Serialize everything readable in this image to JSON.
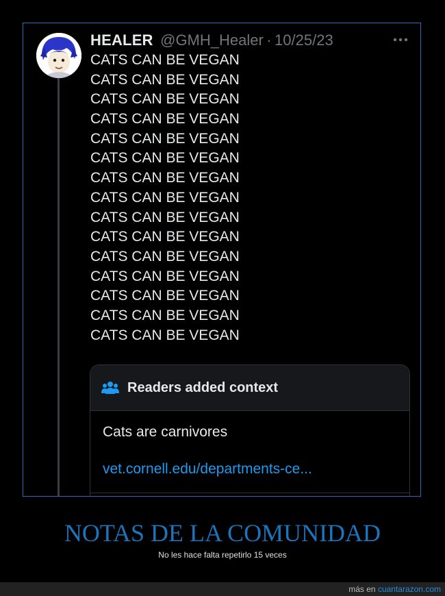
{
  "tweet": {
    "author_name": "HEALER",
    "author_handle": "@GMH_Healer",
    "separator": "·",
    "date": "10/25/23",
    "more_icon": "more-horizontal-icon",
    "lines": [
      "CATS CAN BE VEGAN",
      "CATS CAN BE VEGAN",
      "CATS CAN BE VEGAN",
      "CATS CAN BE VEGAN",
      "CATS CAN BE VEGAN",
      "CATS CAN BE VEGAN",
      "CATS CAN BE VEGAN",
      "CATS CAN BE VEGAN",
      "CATS CAN BE VEGAN",
      "CATS CAN BE VEGAN",
      "CATS CAN BE VEGAN",
      "CATS CAN BE VEGAN",
      "CATS CAN BE VEGAN",
      "CATS CAN BE VEGAN",
      "CATS CAN BE VEGAN"
    ]
  },
  "context_card": {
    "icon": "people-icon",
    "title": "Readers added context",
    "text": "Cats are carnivores",
    "link": "vet.cornell.edu/departments-ce..."
  },
  "caption": {
    "headline": "NOTAS DE LA COMUNIDAD",
    "subline": "No les hace falta repetirlo 15 veces"
  },
  "footer": {
    "prefix": "más en",
    "site": "cuantarazon.com"
  },
  "colors": {
    "background": "#000000",
    "frame_border": "#1d6fb8",
    "headline": "#1c75bc",
    "link": "#1d9bf0",
    "text": "#e7e9ea",
    "muted": "#71767b"
  }
}
